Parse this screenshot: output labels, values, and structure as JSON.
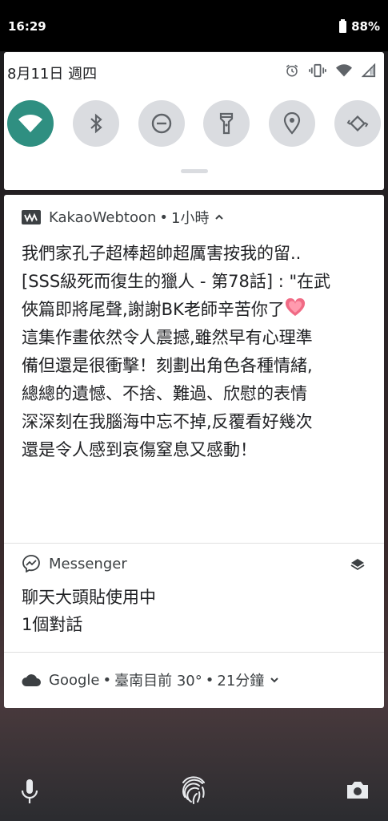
{
  "status_bar": {
    "time": "16:29",
    "battery": "88%"
  },
  "quick_settings": {
    "date": "8月11日 週四",
    "tiles": [
      {
        "icon": "wifi-icon",
        "active": true
      },
      {
        "icon": "bluetooth-icon",
        "active": false
      },
      {
        "icon": "do-not-disturb-icon",
        "active": false
      },
      {
        "icon": "flashlight-icon",
        "active": false
      },
      {
        "icon": "location-icon",
        "active": false
      },
      {
        "icon": "auto-rotate-icon",
        "active": false
      }
    ],
    "accent_color": "#2f8f81"
  },
  "notifications": {
    "kakao": {
      "app": "KakaoWebtoon",
      "time": "1小時",
      "lines": [
        "我們家孔子超棒超帥超厲害按我的留..",
        "[SSS級死而復生的獵人 - 第78話] : \"在武",
        "俠篇即將尾聲,謝謝BK老師辛苦你了",
        "這集作畫依然令人震撼,雖然早有心理準",
        "備但還是很衝擊！刻劃出角色各種情緒,",
        "總總的遺憾、不捨、難過、欣慰的表情",
        "深深刻在我腦海中忘不掉,反覆看好幾次",
        "還是令人感到哀傷窒息又感動！"
      ]
    },
    "messenger": {
      "app": "Messenger",
      "title": "聊天大頭貼使用中",
      "subtitle": "1個對話"
    },
    "google": {
      "app": "Google",
      "summary": "臺南目前 30°",
      "time": "21分鐘"
    }
  },
  "bottom_bar": {
    "left": "mic-icon",
    "center": "fingerprint-icon",
    "right": "camera-icon"
  }
}
